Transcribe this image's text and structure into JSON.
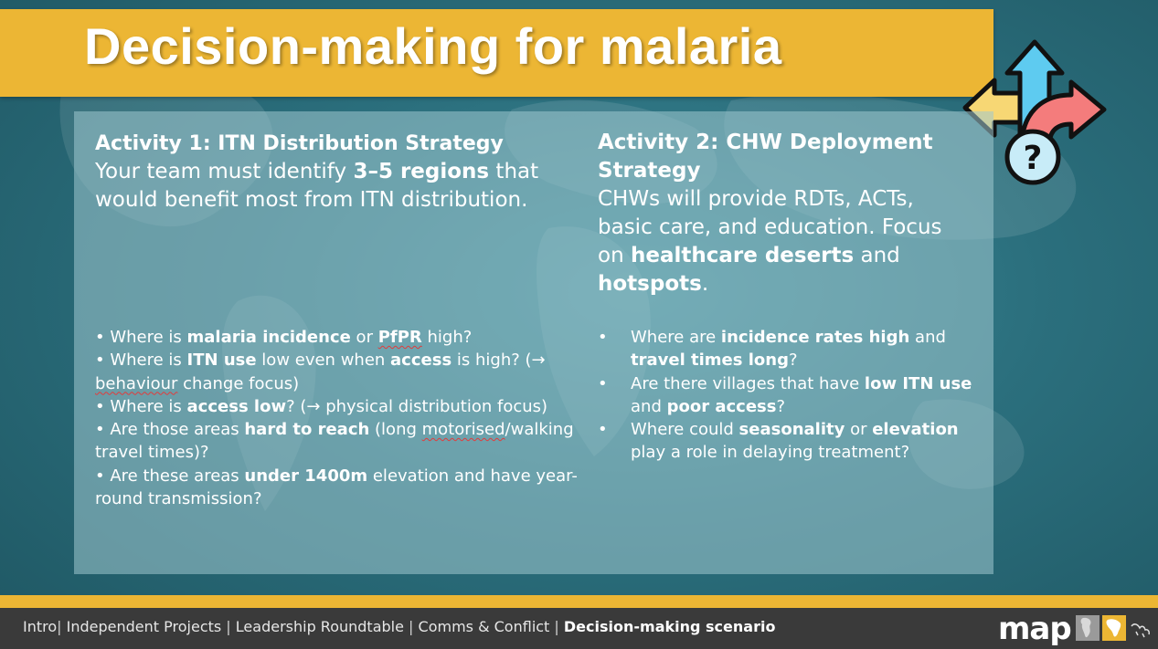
{
  "slide": {
    "title": "Decision-making for malaria"
  },
  "activity1": {
    "heading": "Activity 1: ITN Distribution Strategy",
    "intro": {
      "a": "Your team must identify ",
      "b": "3–5 regions",
      "c": " that would benefit most from ITN distribution."
    },
    "bullets": [
      {
        "a": "Where is ",
        "b": "malaria incidence",
        "c": " or ",
        "d": "PfPR",
        "e": " high?"
      },
      {
        "a": "Where is ",
        "b": "ITN use",
        "c": " low even when ",
        "d": "access",
        "e": " is high? (→ ",
        "f": "behaviour",
        "g": " change focus)"
      },
      {
        "a": "Where is ",
        "b": "access low",
        "c": "? (→ physical distribution focus)"
      },
      {
        "a": "Are those areas ",
        "b": "hard to reach",
        "c": " (long ",
        "d": "motorised",
        "e": "/walking travel times)?"
      },
      {
        "a": "Are these areas ",
        "b": "under 1400m",
        "c": " elevation and have year-round transmission?"
      }
    ]
  },
  "activity2": {
    "heading": "Activity 2: CHW Deployment Strategy",
    "intro": {
      "a": "CHWs will provide RDTs, ACTs, basic care, and education. Focus on ",
      "b": "healthcare deserts",
      "c": " and ",
      "d": "hotspots",
      "e": "."
    },
    "bullets": [
      {
        "a": "Where are ",
        "b": "incidence rates high",
        "c": " and ",
        "d": "travel times long",
        "e": "?"
      },
      {
        "a": "Are there villages that have ",
        "b": "low ITN use",
        "c": " and ",
        "d": "poor access",
        "e": "?"
      },
      {
        "a": "Where could ",
        "b": "seasonality",
        "c": " or ",
        "d": "elevation",
        "e": " play a role in delaying treatment?"
      }
    ]
  },
  "footer": {
    "nav": [
      "Intro",
      "Independent Projects",
      "Leadership Roundtable",
      "Comms & Conflict",
      "Decision-making scenario"
    ],
    "separators": [
      "| ",
      " | ",
      " | ",
      " | "
    ],
    "logo": "map"
  },
  "colors": {
    "accent": "#ecb634",
    "footer": "#3a3a3a",
    "arrow_blue": "#5ecbf0",
    "arrow_yellow": "#f7d774",
    "arrow_red": "#f47c7c"
  },
  "icons": {
    "decision": "crossroads-arrows-question-icon"
  }
}
